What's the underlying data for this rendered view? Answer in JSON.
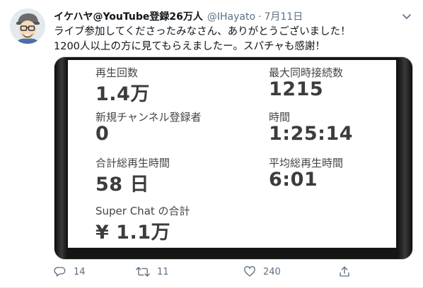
{
  "tweet": {
    "display_name": "イケハヤ@YouTube登録26万人",
    "handle": "@IHayato",
    "separator": "·",
    "date": "7月11日",
    "text_lines": [
      "ライブ参加してくださったみなさん、ありがとうございました！",
      "1200人以上の方に見てもらえましたー。スパチャも感謝！"
    ]
  },
  "stats": {
    "views": {
      "label": "再生回数",
      "value": "1.4万"
    },
    "max_concurrent": {
      "label": "最大同時接続数",
      "value": "1215"
    },
    "new_subscribers": {
      "label": "新規チャンネル登録者",
      "value": "0"
    },
    "duration": {
      "label": "時間",
      "value": "1:25:14"
    },
    "total_watch_time": {
      "label": "合計総再生時間",
      "value": "58 日"
    },
    "avg_watch_time": {
      "label": "平均総再生時間",
      "value": "6:01"
    },
    "super_chat": {
      "label": "Super Chat の合計",
      "value": "¥ 1.1万"
    }
  },
  "actions": {
    "replies": "14",
    "retweets": "11",
    "likes": "240"
  },
  "icons": {
    "reply": "reply-icon",
    "retweet": "retweet-icon",
    "like": "heart-icon",
    "share": "share-icon",
    "more": "chevron-down-icon"
  },
  "colors": {
    "secondary_text": "#5b7083",
    "primary_text": "#0f1419"
  }
}
